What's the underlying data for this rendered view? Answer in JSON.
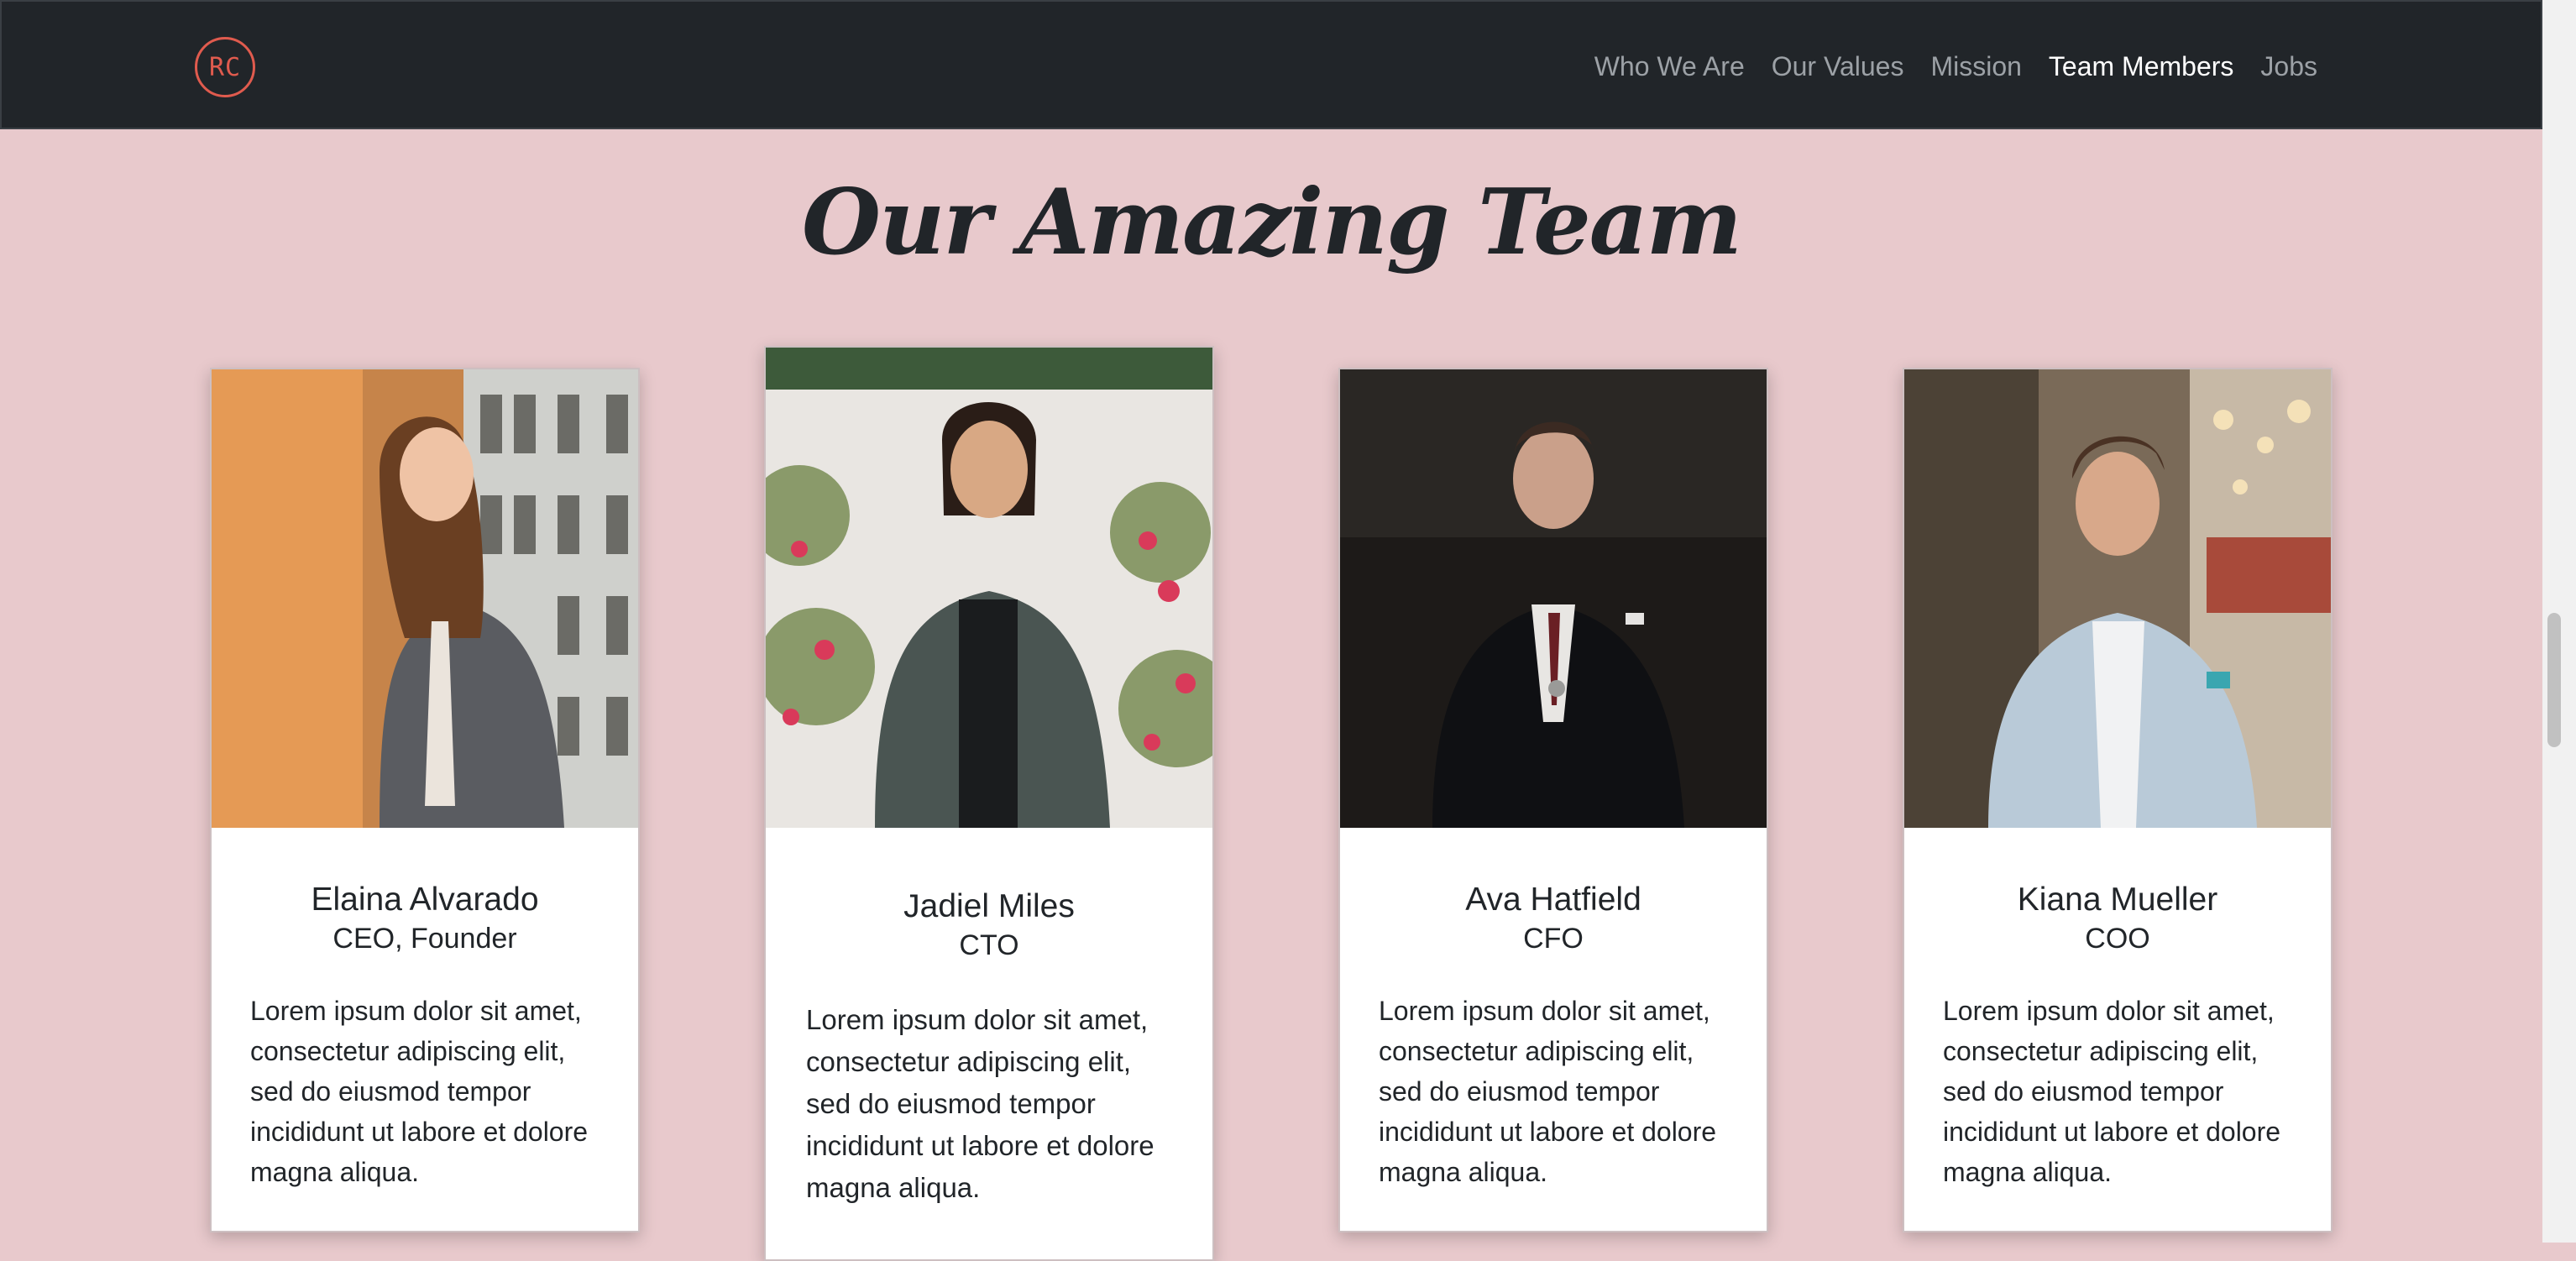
{
  "brand": {
    "logo_text": "RC",
    "accent": "#e05b4e"
  },
  "nav": {
    "items": [
      {
        "label": "Who We Are",
        "active": false
      },
      {
        "label": "Our Values",
        "active": false
      },
      {
        "label": "Mission",
        "active": false
      },
      {
        "label": "Team Members",
        "active": true
      },
      {
        "label": "Jobs",
        "active": false
      }
    ]
  },
  "page": {
    "title": "Our Amazing Team",
    "background": "#e8c9cc"
  },
  "team": [
    {
      "name": "Elaina Alvarado",
      "role": "CEO, Founder",
      "bio": "Lorem ipsum dolor sit amet, consectetur adipiscing elit, sed do eiusmod tempor incididunt ut labore et dolore magna aliqua."
    },
    {
      "name": "Jadiel Miles",
      "role": "CTO",
      "bio": "Lorem ipsum dolor sit amet, consectetur adipiscing elit, sed do eiusmod tempor incididunt ut labore et dolore magna aliqua."
    },
    {
      "name": "Ava Hatfield",
      "role": "CFO",
      "bio": "Lorem ipsum dolor sit amet, consectetur adipiscing elit, sed do eiusmod tempor incididunt ut labore et dolore magna aliqua."
    },
    {
      "name": "Kiana Mueller",
      "role": "COO",
      "bio": "Lorem ipsum dolor sit amet, consectetur adipiscing elit, sed do eiusmod tempor incididunt ut labore et dolore magna aliqua."
    }
  ]
}
